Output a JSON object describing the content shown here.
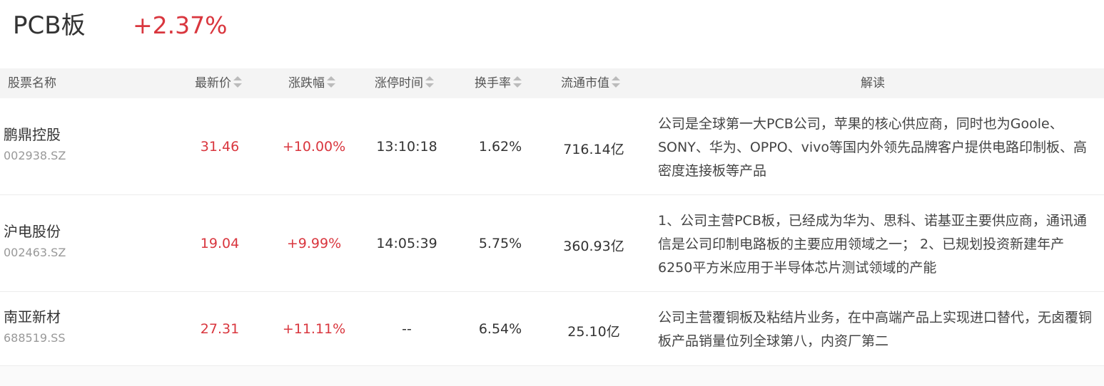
{
  "header": {
    "sector_name": "PCB板",
    "sector_change": "+2.37%"
  },
  "colors": {
    "up": "#d9363e",
    "header_bg": "#f4f4f4"
  },
  "table": {
    "columns": [
      {
        "key": "name",
        "label": "股票名称",
        "sortable": false
      },
      {
        "key": "price",
        "label": "最新价",
        "sortable": true
      },
      {
        "key": "change",
        "label": "涨跌幅",
        "sortable": true
      },
      {
        "key": "limit_time",
        "label": "涨停时间",
        "sortable": true
      },
      {
        "key": "turnover",
        "label": "换手率",
        "sortable": true
      },
      {
        "key": "market_cap",
        "label": "流通市值",
        "sortable": true
      },
      {
        "key": "reading",
        "label": "解读",
        "sortable": false
      }
    ],
    "rows": [
      {
        "name": "鹏鼎控股",
        "code": "002938.SZ",
        "price": "31.46",
        "change": "+10.00%",
        "limit_time": "13:10:18",
        "turnover": "1.62%",
        "market_cap": "716.14亿",
        "reading": "公司是全球第一大PCB公司，苹果的核心供应商，同时也为Goole、SONY、华为、OPPO、vivo等国内外领先品牌客户提供电路印制板、高密度连接板等产品"
      },
      {
        "name": "沪电股份",
        "code": "002463.SZ",
        "price": "19.04",
        "change": "+9.99%",
        "limit_time": "14:05:39",
        "turnover": "5.75%",
        "market_cap": "360.93亿",
        "reading": "1、公司主营PCB板，已经成为华为、思科、诺基亚主要供应商，通讯通信是公司印制电路板的主要应用领域之一； 2、已规划投资新建年产6250平方米应用于半导体芯片测试领域的产能"
      },
      {
        "name": "南亚新材",
        "code": "688519.SS",
        "price": "27.31",
        "change": "+11.11%",
        "limit_time": "--",
        "turnover": "6.54%",
        "market_cap": "25.10亿",
        "reading": "公司主营覆铜板及粘结片业务，在中高端产品上实现进口替代，无卤覆铜板产品销量位列全球第八，内资厂第二"
      }
    ]
  }
}
